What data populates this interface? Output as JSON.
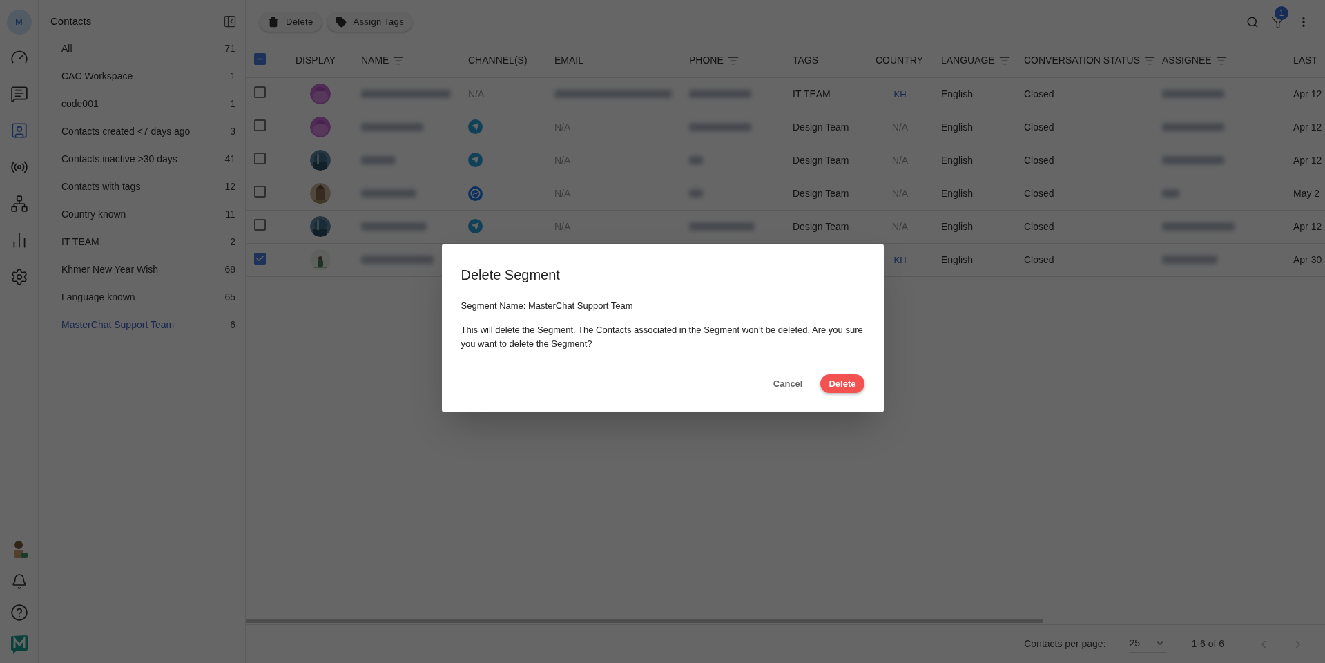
{
  "rail": {
    "avatar_initial": "M",
    "items": [
      {
        "kind": "dashboard",
        "selected": false
      },
      {
        "kind": "chats",
        "selected": false
      },
      {
        "kind": "contacts",
        "selected": true
      },
      {
        "kind": "broadcast",
        "selected": false
      },
      {
        "kind": "flows",
        "selected": false
      },
      {
        "kind": "reports",
        "selected": false
      },
      {
        "kind": "settings",
        "selected": false
      }
    ]
  },
  "segments": {
    "title": "Contacts",
    "items": [
      {
        "label": "All",
        "count": "71",
        "selected": false
      },
      {
        "label": "CAC Workspace",
        "count": "1",
        "selected": false
      },
      {
        "label": "code001",
        "count": "1",
        "selected": false
      },
      {
        "label": "Contacts created <7 days ago",
        "count": "3",
        "selected": false
      },
      {
        "label": "Contacts inactive >30 days",
        "count": "41",
        "selected": false
      },
      {
        "label": "Contacts with tags",
        "count": "12",
        "selected": false
      },
      {
        "label": "Country known",
        "count": "11",
        "selected": false
      },
      {
        "label": "IT TEAM",
        "count": "2",
        "selected": false
      },
      {
        "label": "Khmer New Year Wish",
        "count": "68",
        "selected": false
      },
      {
        "label": "Language known",
        "count": "65",
        "selected": false
      },
      {
        "label": "MasterChat Support Team",
        "count": "6",
        "selected": true
      }
    ]
  },
  "toolbar": {
    "buttons": [
      {
        "kind": "delete",
        "label": "Delete"
      },
      {
        "kind": "tags",
        "label": "Assign Tags"
      }
    ],
    "filter_badge": "1"
  },
  "table": {
    "select_all_partial": true,
    "columns": [
      {
        "label": "DISPLAY",
        "sortable": false
      },
      {
        "label": "NAME",
        "sortable": true
      },
      {
        "label": "CHANNEL(S)",
        "sortable": false
      },
      {
        "label": "EMAIL",
        "sortable": false
      },
      {
        "label": "PHONE",
        "sortable": true
      },
      {
        "label": "TAGS",
        "sortable": false
      },
      {
        "label": "COUNTRY",
        "sortable": false
      },
      {
        "label": "LANGUAGE",
        "sortable": true
      },
      {
        "label": "CONVERSATION STATUS",
        "sortable": true
      },
      {
        "label": "ASSIGNEE",
        "sortable": true
      },
      {
        "label": "LAST",
        "sortable": false
      }
    ],
    "rows": [
      {
        "checked": false,
        "channel": {
          "kind": "text",
          "label": "N/A"
        },
        "tags": "IT TEAM",
        "country": {
          "text": "KH",
          "known": true
        },
        "language": "English",
        "status": "Closed",
        "last": "Apr 12"
      },
      {
        "checked": false,
        "channel": {
          "kind": "telegram"
        },
        "email": "N/A",
        "tags": "Design Team",
        "country": {
          "text": "N/A",
          "known": false
        },
        "language": "English",
        "status": "Closed",
        "last": "Apr 12"
      },
      {
        "checked": false,
        "channel": {
          "kind": "telegram"
        },
        "email": "N/A",
        "tags": "Design Team",
        "country": {
          "text": "N/A",
          "known": false
        },
        "language": "English",
        "status": "Closed",
        "last": "Apr 12"
      },
      {
        "checked": false,
        "channel": {
          "kind": "messenger"
        },
        "email": "N/A",
        "tags": "Design Team",
        "country": {
          "text": "N/A",
          "known": false
        },
        "language": "English",
        "status": "Closed",
        "last": "May 2"
      },
      {
        "checked": false,
        "channel": {
          "kind": "telegram"
        },
        "email": "N/A",
        "tags": "Design Team",
        "country": {
          "text": "N/A",
          "known": false
        },
        "language": "English",
        "status": "Closed",
        "last": "Apr 12"
      },
      {
        "checked": true,
        "country": {
          "text": "KH",
          "known": true
        },
        "language": "English",
        "status": "Closed",
        "last": "Apr 30"
      }
    ]
  },
  "pagination": {
    "label": "Contacts per page:",
    "per_page": "25",
    "range": "1-6 of 6"
  },
  "dialog": {
    "title": "Delete Segment",
    "segment_line": "Segment Name: MasterChat Support Team",
    "message": "This will delete the Segment. The Contacts associated in the Segment won’t be deleted. Are you sure you want to delete the Segment?",
    "buttons": [
      {
        "kind": "cancel",
        "label": "Cancel"
      },
      {
        "kind": "confirm",
        "label": "Delete"
      }
    ]
  }
}
